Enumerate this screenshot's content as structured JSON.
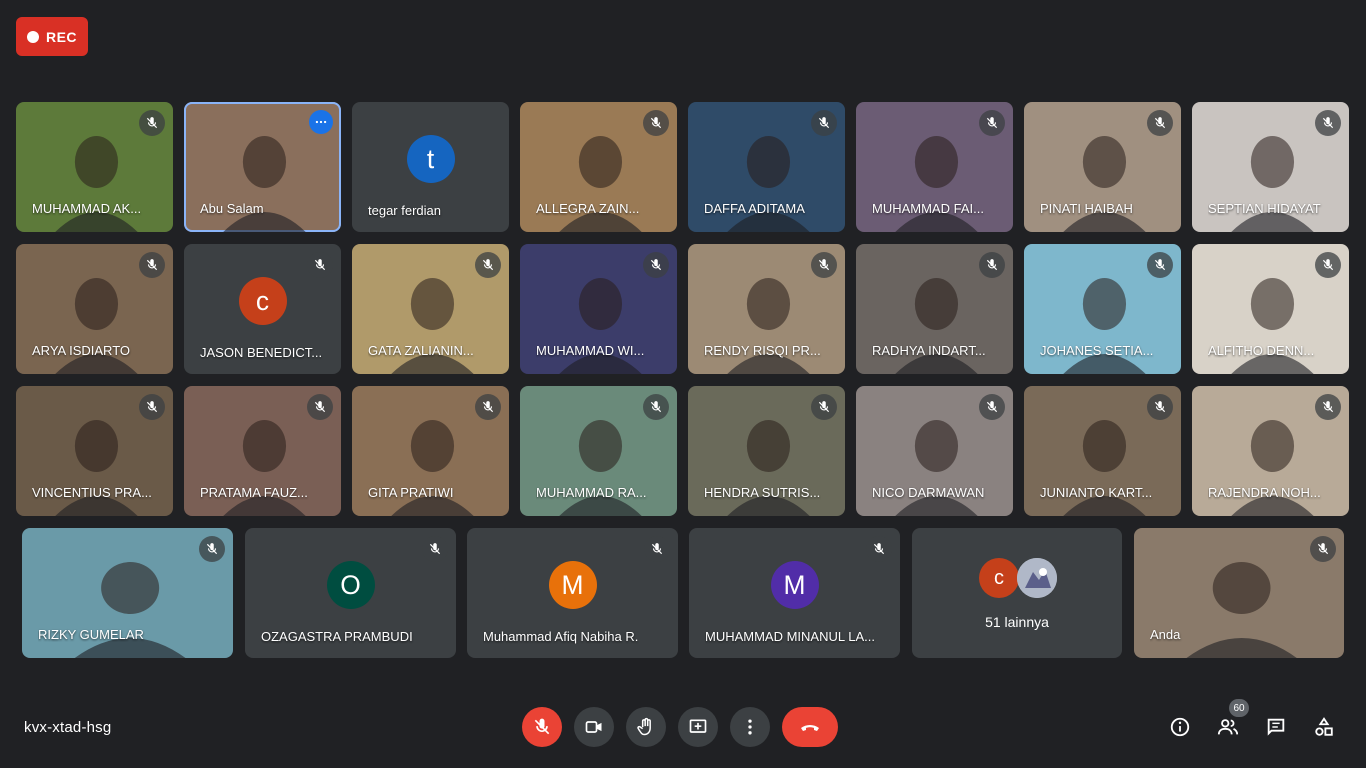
{
  "recording": {
    "label": "REC"
  },
  "meeting": {
    "code": "kvx-xtad-hsg"
  },
  "participants": [
    {
      "name": "MUHAMMAD AK...",
      "muted": true,
      "bg": "#5d7a3a"
    },
    {
      "name": "Abu Salam",
      "muted": false,
      "active": true,
      "bg": "#8a6f5c"
    },
    {
      "name": "tegar ferdian",
      "muted": false,
      "avatar_letter": "t",
      "avatar_color": "#1565c0"
    },
    {
      "name": "ALLEGRA ZAIN...",
      "muted": true,
      "bg": "#9a7a55"
    },
    {
      "name": "DAFFA ADITAMA",
      "muted": true,
      "bg": "#2f4b68"
    },
    {
      "name": "MUHAMMAD FAI...",
      "muted": true,
      "bg": "#6b5c74"
    },
    {
      "name": "PINATI HAIBAH",
      "muted": true,
      "bg": "#a09080"
    },
    {
      "name": "SEPTIAN HIDAYAT",
      "muted": true,
      "bg": "#c9c4c0"
    },
    {
      "name": "ARYA ISDIARTO",
      "muted": true,
      "bg": "#7a6550"
    },
    {
      "name": "JASON BENEDICT...",
      "muted": true,
      "avatar_letter": "c",
      "avatar_color": "#c5401a"
    },
    {
      "name": "GATA ZALIANIN...",
      "muted": true,
      "bg": "#b09a6a"
    },
    {
      "name": "MUHAMMAD WI...",
      "muted": true,
      "bg": "#3c3d6a"
    },
    {
      "name": "RENDY RISQI PR...",
      "muted": true,
      "bg": "#9c8a74"
    },
    {
      "name": "RADHYA INDART...",
      "muted": true,
      "bg": "#6a6460"
    },
    {
      "name": "JOHANES SETIA...",
      "muted": true,
      "bg": "#7eb7cc"
    },
    {
      "name": "ALFITHO DENN...",
      "muted": true,
      "bg": "#d8d2c8"
    },
    {
      "name": "VINCENTIUS PRA...",
      "muted": true,
      "bg": "#6a5a48"
    },
    {
      "name": "PRATAMA FAUZ...",
      "muted": true,
      "bg": "#7a5f55"
    },
    {
      "name": "GITA PRATIWI",
      "muted": true,
      "bg": "#8a6f55"
    },
    {
      "name": "MUHAMMAD RA...",
      "muted": true,
      "bg": "#6a8a7a"
    },
    {
      "name": "HENDRA SUTRIS...",
      "muted": true,
      "bg": "#6a6a5a"
    },
    {
      "name": "NICO DARMAWAN",
      "muted": true,
      "bg": "#8a8280"
    },
    {
      "name": "JUNIANTO KART...",
      "muted": true,
      "bg": "#7a6a58"
    },
    {
      "name": "RAJENDRA NOH...",
      "muted": true,
      "bg": "#b8aa98"
    },
    {
      "name": "RIZKY GUMELAR",
      "muted": true,
      "bg": "#6a9aa8"
    },
    {
      "name": "OZAGASTRA PRAMBUDI",
      "muted": true,
      "avatar_letter": "O",
      "avatar_color": "#004d40"
    },
    {
      "name": "Muhammad Afiq Nabiha R.",
      "muted": true,
      "avatar_letter": "M",
      "avatar_color": "#e8710a"
    },
    {
      "name": "MUHAMMAD MINANUL LA...",
      "muted": true,
      "avatar_letter": "M",
      "avatar_color": "#512da8"
    },
    {
      "name": "Anda",
      "muted": true,
      "bg": "#8a7a6a"
    }
  ],
  "others": {
    "label": "51 lainnya",
    "avatar_letter": "c",
    "avatar_color": "#c5401a"
  },
  "controls": {
    "mic": "mic-off-icon",
    "camera": "camera-icon",
    "raise_hand": "hand-icon",
    "present": "present-icon",
    "more": "more-vert-icon",
    "leave": "end-call-icon"
  },
  "right_controls": {
    "info": "info-icon",
    "people_count": "60",
    "chat": "chat-icon",
    "activities": "activities-icon"
  }
}
